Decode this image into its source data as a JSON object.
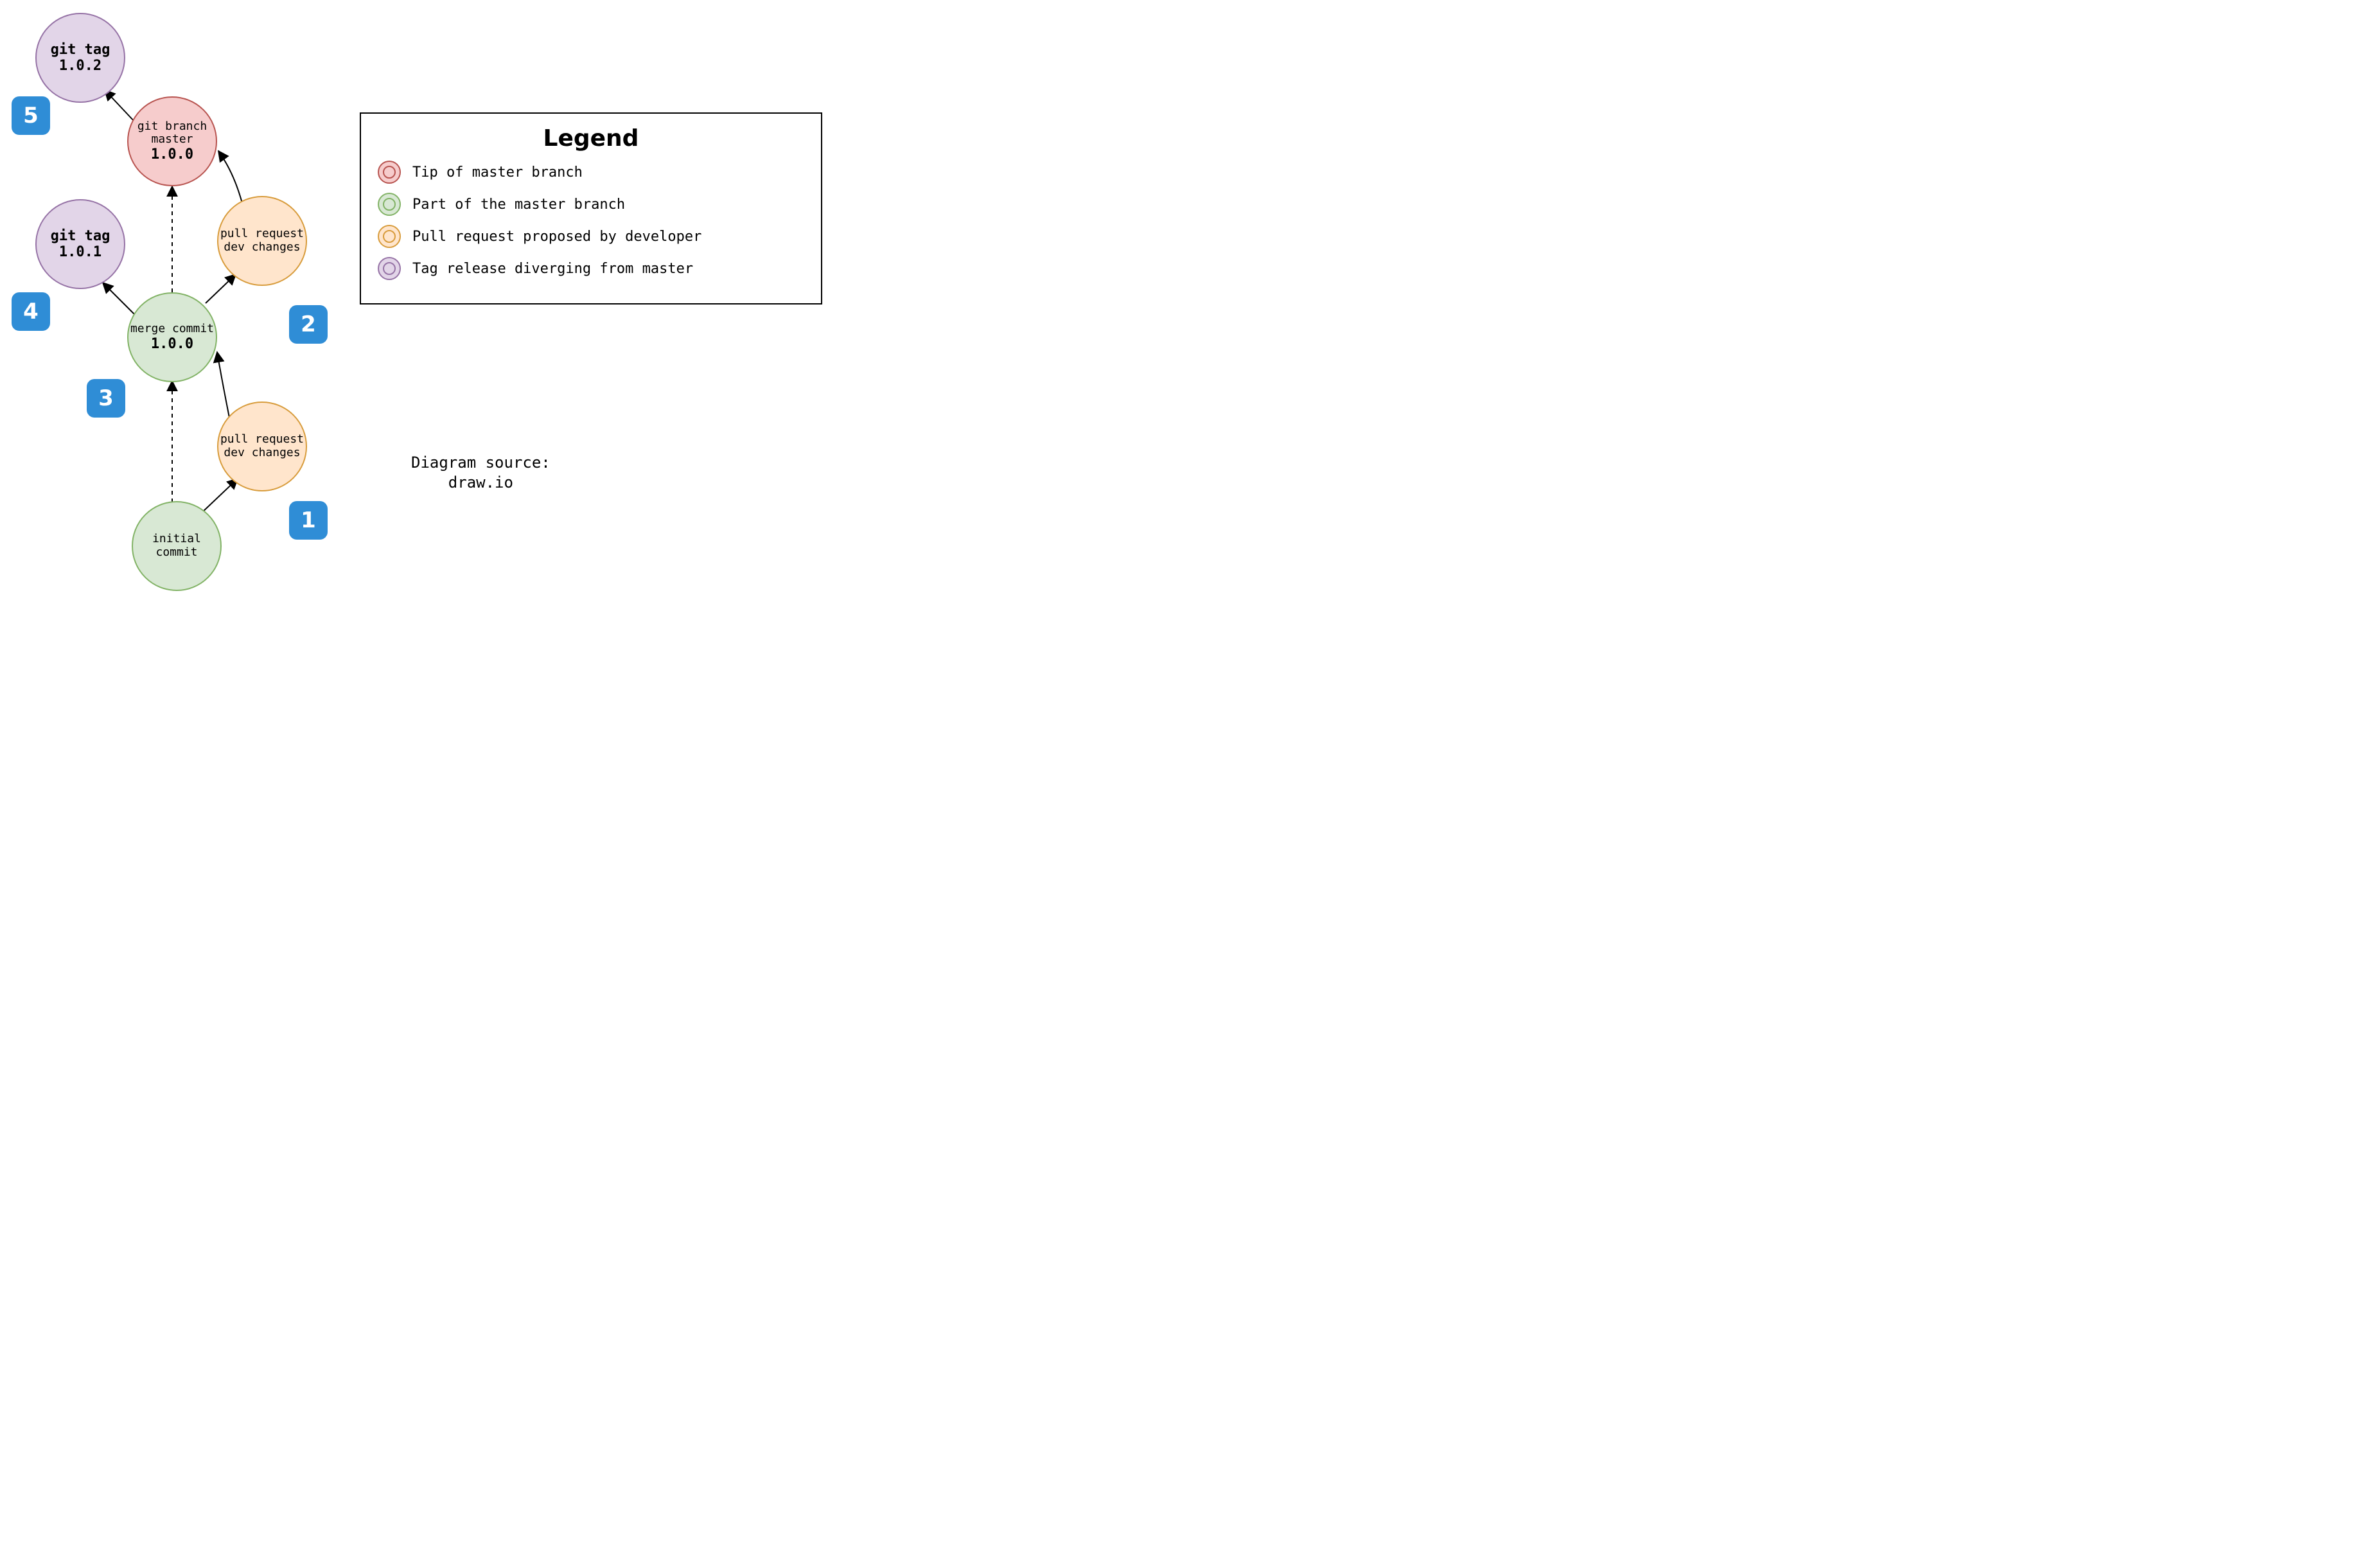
{
  "nodes": {
    "tag102": {
      "line1": "git tag",
      "line2": "1.0.2"
    },
    "master": {
      "line1": "git branch",
      "line2": "master",
      "line3": "1.0.0"
    },
    "tag101": {
      "line1": "git tag",
      "line2": "1.0.1"
    },
    "pr2": {
      "line1": "pull request",
      "line2": "dev changes"
    },
    "merge": {
      "line1": "merge commit",
      "line2": "1.0.0"
    },
    "pr1": {
      "line1": "pull request",
      "line2": "dev changes"
    },
    "initial": {
      "line1": "initial",
      "line2": "commit"
    }
  },
  "badges": {
    "b1": "1",
    "b2": "2",
    "b3": "3",
    "b4": "4",
    "b5": "5"
  },
  "legend": {
    "title": "Legend",
    "items": [
      {
        "color": "red",
        "label": "Tip of master branch"
      },
      {
        "color": "green",
        "label": "Part of the master branch"
      },
      {
        "color": "orange",
        "label": "Pull request proposed by developer"
      },
      {
        "color": "purple",
        "label": "Tag release diverging from master"
      }
    ]
  },
  "caption": {
    "line1": "Diagram source:",
    "line2": "draw.io"
  }
}
